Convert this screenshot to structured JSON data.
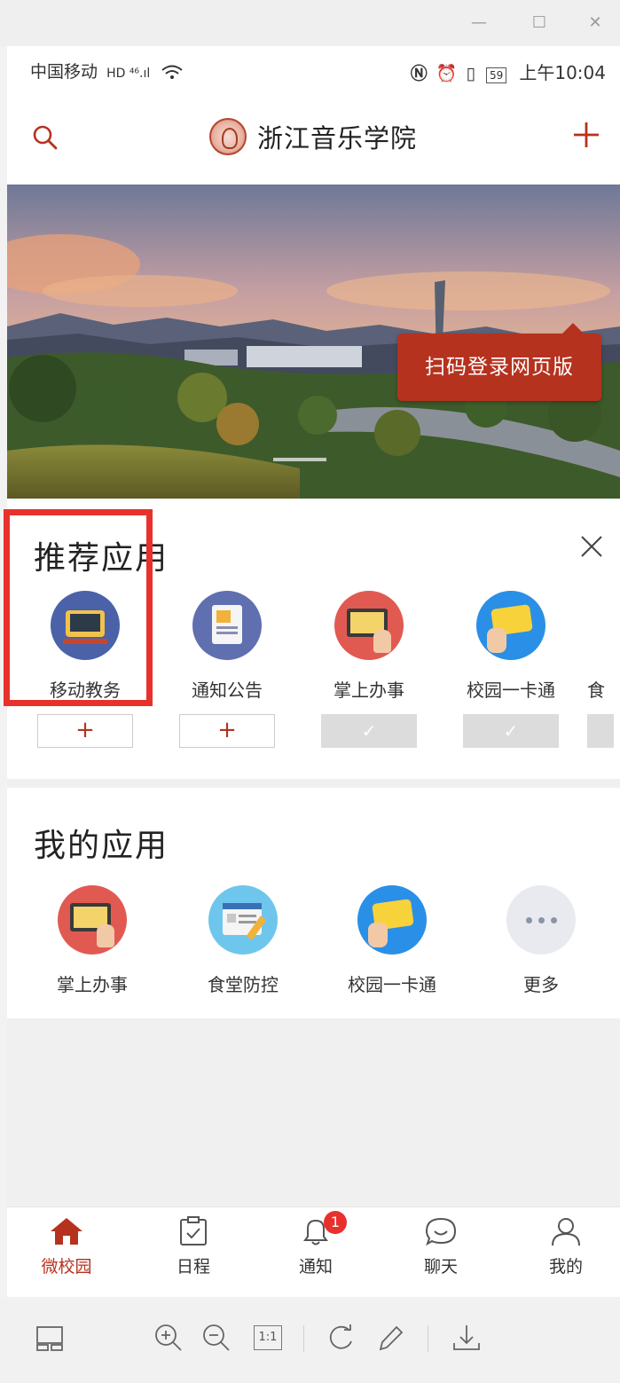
{
  "window": {
    "minimize_glyph": "—",
    "maximize_glyph": "☐",
    "close_glyph": "✕"
  },
  "status_bar": {
    "carrier": "中国移动",
    "network": "HD ⁴⁶.ıl",
    "battery": "59",
    "time": "上午10:04"
  },
  "header": {
    "title": "浙江音乐学院"
  },
  "banner": {
    "qr_login_label": "扫码登录网页版"
  },
  "recommended": {
    "title": "推荐应用",
    "items": [
      {
        "label": "移动教务",
        "icon": "classroom-board-icon",
        "action": "+",
        "added": false
      },
      {
        "label": "通知公告",
        "icon": "notice-document-icon",
        "action": "+",
        "added": false
      },
      {
        "label": "掌上办事",
        "icon": "tablet-hand-icon",
        "action": "✓",
        "added": true
      },
      {
        "label": "校园一卡通",
        "icon": "campus-card-icon",
        "action": "✓",
        "added": true
      },
      {
        "label": "食",
        "icon": "partial-icon",
        "action": "",
        "added": true
      }
    ]
  },
  "my_apps": {
    "title": "我的应用",
    "items": [
      {
        "label": "掌上办事",
        "icon": "tablet-hand-icon"
      },
      {
        "label": "食堂防控",
        "icon": "form-pencil-icon"
      },
      {
        "label": "校园一卡通",
        "icon": "campus-card-icon"
      },
      {
        "label": "更多",
        "icon": "more-dots-icon"
      }
    ]
  },
  "tabs": [
    {
      "label": "微校园",
      "icon": "home-icon",
      "active": true
    },
    {
      "label": "日程",
      "icon": "calendar-check-icon",
      "active": false
    },
    {
      "label": "通知",
      "icon": "bell-icon",
      "active": false,
      "badge": "1"
    },
    {
      "label": "聊天",
      "icon": "chat-icon",
      "active": false
    },
    {
      "label": "我的",
      "icon": "person-icon",
      "active": false
    }
  ],
  "viewer_toolbar": {
    "zoom_reset_label": "1:1"
  },
  "colors": {
    "brand": "#b5321f",
    "highlight": "#e8312c",
    "added_button": "#dcdcdc"
  }
}
